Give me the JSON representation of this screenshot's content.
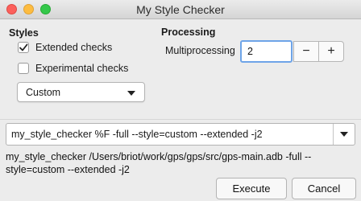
{
  "window": {
    "title": "My Style Checker"
  },
  "styles": {
    "heading": "Styles",
    "extended_label": "Extended checks",
    "extended_checked": true,
    "experimental_label": "Experimental checks",
    "experimental_checked": false,
    "style_select_value": "Custom"
  },
  "processing": {
    "heading": "Processing",
    "multiprocessing_label": "Multiprocessing",
    "multiprocessing_value": "2",
    "decrement_label": "−",
    "increment_label": "+"
  },
  "command": {
    "combo_value": "my_style_checker %F -full --style=custom --extended -j2",
    "preview": "my_style_checker /Users/briot/work/gps/gps/src/gps-main.adb -full --style=custom --extended -j2"
  },
  "footer": {
    "execute_label": "Execute",
    "cancel_label": "Cancel"
  },
  "colors": {
    "focus_ring": "#6ea4e8",
    "close": "#fc605c",
    "minimize": "#fdbc40",
    "maximize": "#34c84a"
  }
}
